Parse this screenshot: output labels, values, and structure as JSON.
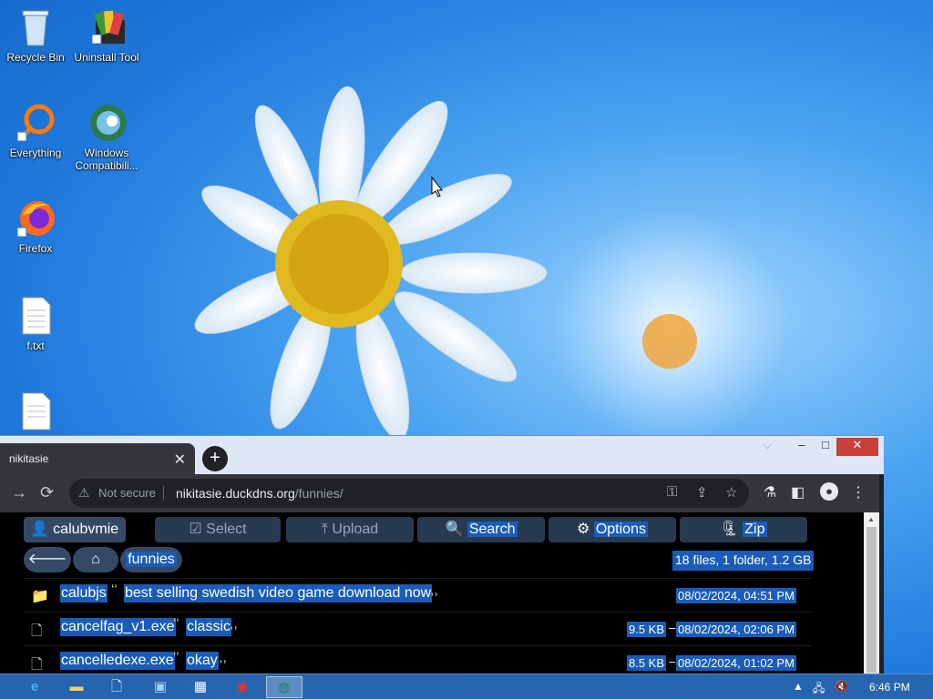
{
  "desktop": {
    "icons": [
      {
        "label": "Recycle Bin",
        "icon": "recycle-bin-icon"
      },
      {
        "label": "Uninstall Tool",
        "icon": "uninstall-tool-icon"
      },
      {
        "label": "Everything",
        "icon": "everything-search-icon"
      },
      {
        "label": "Windows Compatibili...",
        "icon": "windows-compatibility-icon"
      },
      {
        "label": "Firefox",
        "icon": "firefox-icon"
      },
      {
        "label": "f.txt",
        "icon": "text-file-icon"
      }
    ]
  },
  "browser": {
    "tab_title": "nikitasie",
    "tab_close": "✕",
    "new_tab": "+",
    "address": {
      "security_text": "Not secure",
      "host": "nikitasie.duckdns.org",
      "path": "/funnies/"
    }
  },
  "page": {
    "buttons": [
      {
        "label": "calubvmie",
        "icon": "user-icon",
        "active": true
      },
      {
        "label": "Select",
        "icon": "checkbox-icon"
      },
      {
        "label": "Upload",
        "icon": "upload-icon"
      },
      {
        "label": "Search",
        "icon": "search-icon"
      },
      {
        "label": "Options",
        "icon": "gear-icon"
      },
      {
        "label": "Zip",
        "icon": "zip-icon"
      }
    ],
    "breadcrumb": {
      "current": "funnies"
    },
    "summary": "18 files, 1 folder, 1.2 GB",
    "rows": [
      {
        "type": "folder",
        "name": "calubjs",
        "description": "best selling swedish video game download now",
        "size": "",
        "date": "08/02/2024, 04:51 PM"
      },
      {
        "type": "file",
        "name": "cancelfag_v1.exe",
        "description": "classic",
        "size": "9.5 KB",
        "date": "08/02/2024, 02:06 PM"
      },
      {
        "type": "file",
        "name": "cancelledexe.exe",
        "description": "okay",
        "size": "8.5 KB",
        "date": "08/02/2024, 01:02 PM"
      }
    ]
  },
  "taskbar": {
    "time": "6:46 PM"
  }
}
